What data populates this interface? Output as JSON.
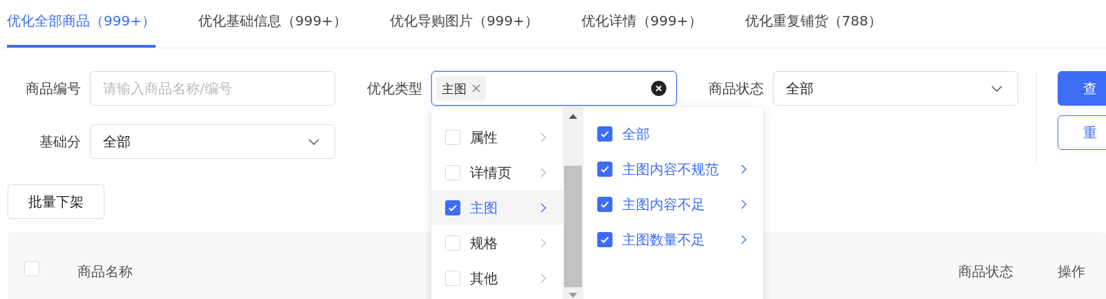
{
  "tabs": [
    {
      "label": "优化全部商品（999+）",
      "selected": true
    },
    {
      "label": "优化基础信息（999+）",
      "selected": false
    },
    {
      "label": "优化导购图片（999+）",
      "selected": false
    },
    {
      "label": "优化详情（999+）",
      "selected": false
    },
    {
      "label": "优化重复铺货（788）",
      "selected": false
    }
  ],
  "filters": [
    {
      "label": "商品编号",
      "kind": "input",
      "placeholder": "请输入商品名称/编号"
    },
    {
      "label": "优化类型",
      "kind": "tags",
      "tags": [
        "主图"
      ]
    },
    {
      "label": "商品状态",
      "kind": "select",
      "value": "全部"
    },
    {
      "label": "基础分",
      "kind": "select",
      "value": "全部"
    }
  ],
  "actions": [
    {
      "label": "查",
      "kind": "primary"
    },
    {
      "label": "重",
      "kind": "outline"
    }
  ],
  "batch_button": "批量下架",
  "table": {
    "header_checkbox": {
      "checked": false
    },
    "columns": [
      "商品名称",
      "商品状态",
      "操作"
    ]
  },
  "dropdown": {
    "categories": [
      {
        "label": "属性",
        "checked": false,
        "selected": false
      },
      {
        "label": "详情页",
        "checked": false,
        "selected": false
      },
      {
        "label": "主图",
        "checked": true,
        "selected": true
      },
      {
        "label": "规格",
        "checked": false,
        "selected": false
      },
      {
        "label": "其他",
        "checked": false,
        "selected": false
      }
    ],
    "options": [
      {
        "label": "全部",
        "checked": true,
        "has_children": false
      },
      {
        "label": "主图内容不规范",
        "checked": true,
        "has_children": true
      },
      {
        "label": "主图内容不足",
        "checked": true,
        "has_children": true
      },
      {
        "label": "主图数量不足",
        "checked": true,
        "has_children": true
      }
    ]
  }
}
